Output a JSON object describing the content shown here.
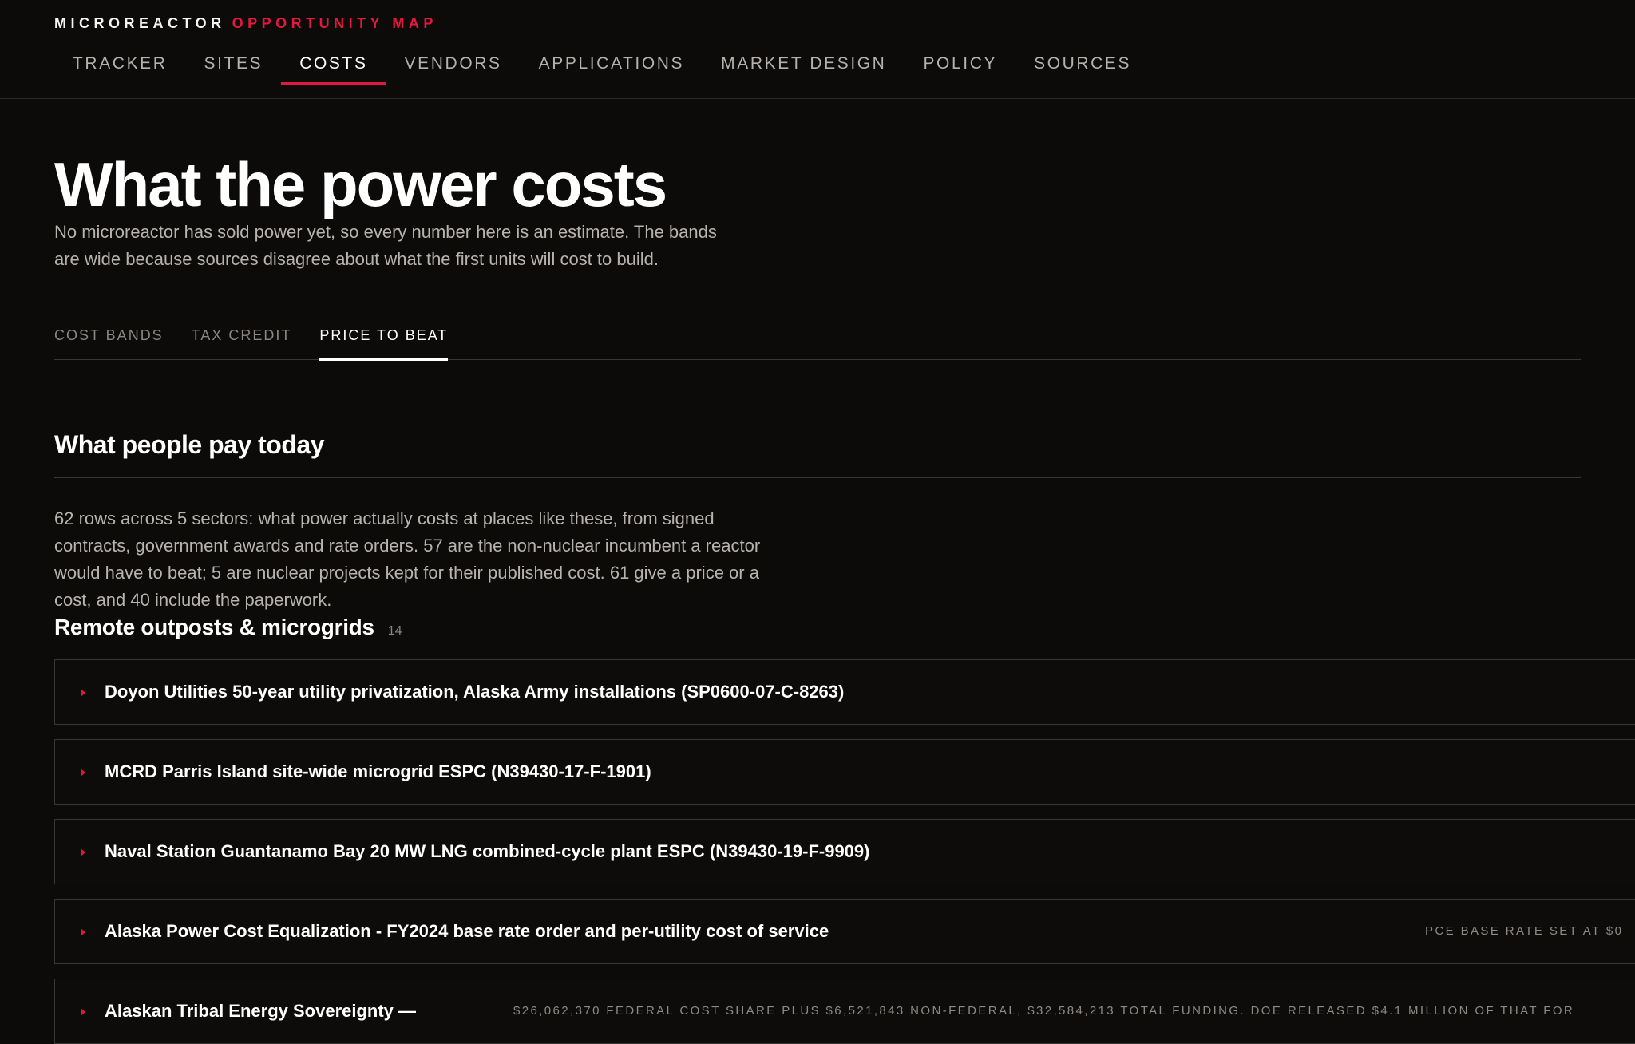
{
  "brand": {
    "part1": "MICROREACTOR",
    "part2": "OPPORTUNITY MAP",
    "accent_color": "#e3183f"
  },
  "nav": {
    "items": [
      {
        "label": "TRACKER",
        "active": false
      },
      {
        "label": "SITES",
        "active": false
      },
      {
        "label": "COSTS",
        "active": true
      },
      {
        "label": "VENDORS",
        "active": false
      },
      {
        "label": "APPLICATIONS",
        "active": false
      },
      {
        "label": "MARKET DESIGN",
        "active": false
      },
      {
        "label": "POLICY",
        "active": false
      },
      {
        "label": "SOURCES",
        "active": false
      }
    ]
  },
  "page": {
    "title": "What the power costs",
    "intro": "No microreactor has sold power yet, so every number here is an estimate. The bands are wide because sources disagree about what the first units will cost to build."
  },
  "tabs": [
    {
      "label": "COST BANDS",
      "active": false
    },
    {
      "label": "TAX CREDIT",
      "active": false
    },
    {
      "label": "PRICE TO BEAT",
      "active": true
    }
  ],
  "section": {
    "title": "What people pay today",
    "description": "62 rows across 5 sectors: what power actually costs at places like these, from signed contracts, government awards and rate orders. 57 are the non-nuclear incumbent a reactor would have to beat; 5 are nuclear projects kept for their published cost. 61 give a price or a cost, and 40 include the paperwork."
  },
  "group": {
    "title": "Remote outposts & microgrids",
    "count": "14",
    "rows": [
      {
        "title": "Doyon Utilities 50-year utility privatization, Alaska Army installations (SP0600-07-C-8263)",
        "note": ""
      },
      {
        "title": "MCRD Parris Island site-wide microgrid ESPC (N39430-17-F-1901)",
        "note": ""
      },
      {
        "title": "Naval Station Guantanamo Bay 20 MW LNG combined-cycle plant ESPC (N39430-19-F-9909)",
        "note": ""
      },
      {
        "title": "Alaska Power Cost Equalization - FY2024 base rate order and per-utility cost of service",
        "note": "PCE BASE RATE SET AT $0"
      },
      {
        "title": "Alaskan Tribal Energy Sovereignty —",
        "note": "$26,062,370 FEDERAL COST SHARE PLUS $6,521,843 NON-FEDERAL, $32,584,213 TOTAL FUNDING. DOE RELEASED $4.1 MILLION OF THAT FOR"
      }
    ]
  }
}
